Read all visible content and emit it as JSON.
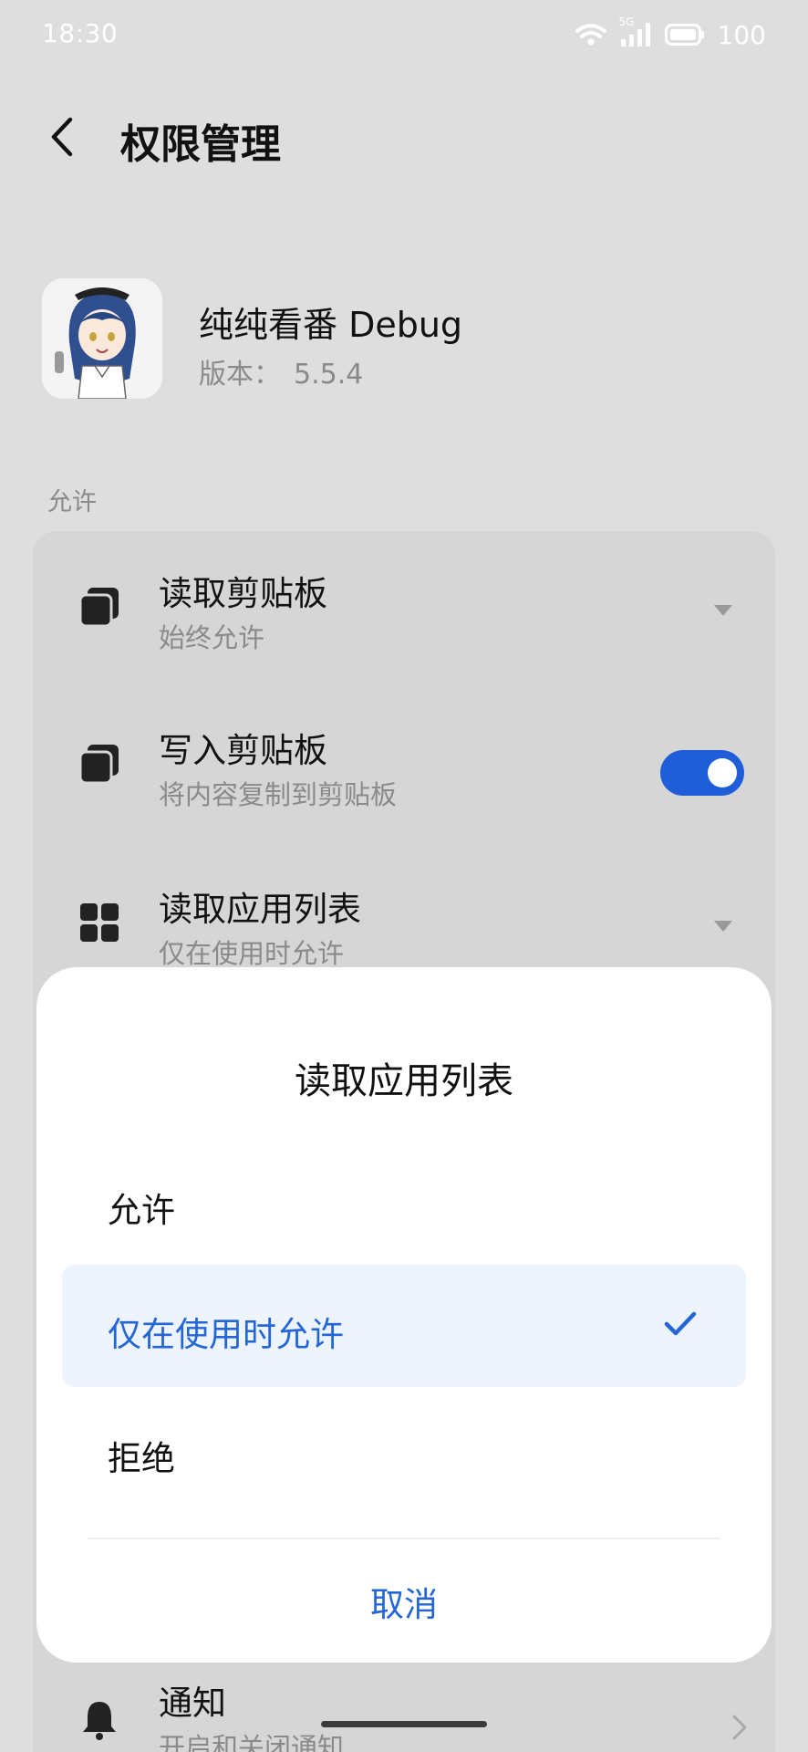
{
  "status_bar": {
    "time": "18:30",
    "network_badge": "5G",
    "battery": "100",
    "icons": [
      "wifi-icon",
      "cellular-signal-icon",
      "battery-icon"
    ]
  },
  "header": {
    "title": "权限管理",
    "back_icon": "chevron-left-icon"
  },
  "app": {
    "name": "纯纯看番 Debug",
    "version_label": "版本：",
    "version": "5.5.4",
    "icon": "app-avatar-icon"
  },
  "section": {
    "label": "允许"
  },
  "permissions": [
    {
      "title": "读取剪贴板",
      "subtitle": "始终允许",
      "icon": "clipboard-icon",
      "control": "dropdown"
    },
    {
      "title": "写入剪贴板",
      "subtitle": "将内容复制到剪贴板",
      "icon": "clipboard-icon",
      "control": "toggle",
      "enabled": true
    },
    {
      "title": "读取应用列表",
      "subtitle": "仅在使用时允许",
      "icon": "app-grid-icon",
      "control": "dropdown"
    },
    {
      "title": "通知",
      "subtitle": "开启和关闭通知",
      "icon": "bell-icon",
      "control": "chevron"
    }
  ],
  "dialog": {
    "title": "读取应用列表",
    "options": [
      {
        "label": "允许",
        "selected": false
      },
      {
        "label": "仅在使用时允许",
        "selected": true
      },
      {
        "label": "拒绝",
        "selected": false
      }
    ],
    "cancel_label": "取消"
  },
  "colors": {
    "accent": "#2466d6",
    "toggle_on": "#1f5ed8",
    "selected_bg": "#eef4fd",
    "scrim_bg": "#dedede"
  }
}
